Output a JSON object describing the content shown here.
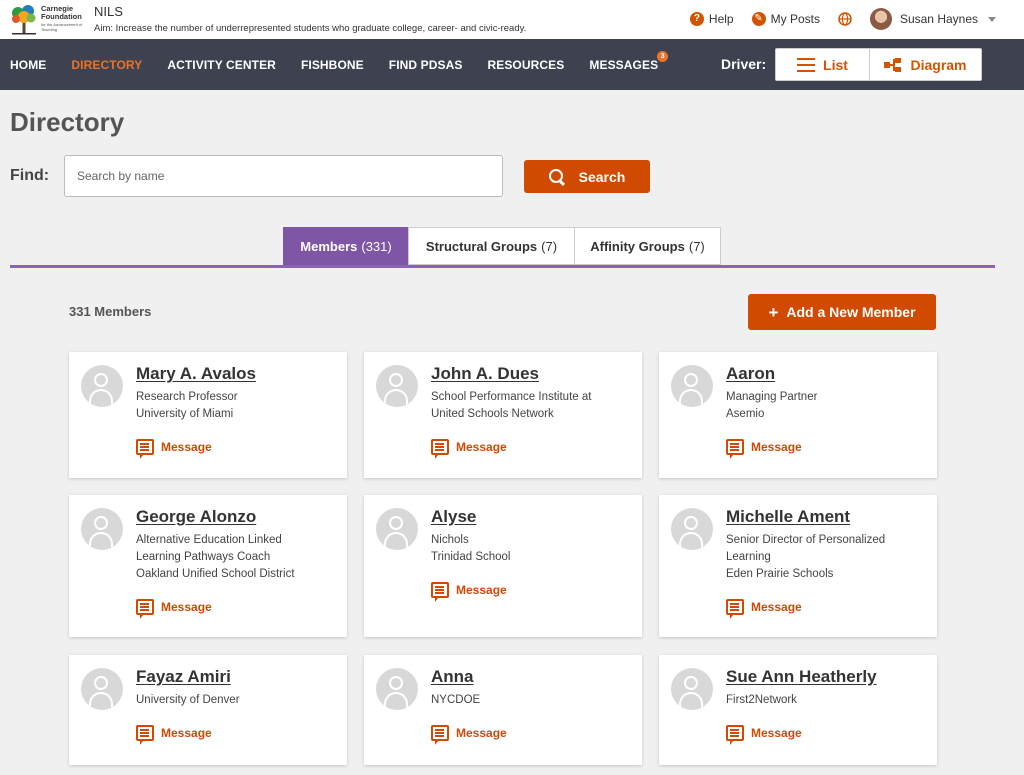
{
  "header": {
    "logo_line1": "Carnegie",
    "logo_line2": "Foundation",
    "logo_sub": "for the Advancement of Teaching",
    "app_name": "NILS",
    "aim": "Aim: Increase the number of underrepresented students who graduate college, career- and civic-ready.",
    "help": "Help",
    "my_posts": "My Posts",
    "user_name": "Susan Haynes"
  },
  "nav": {
    "items": [
      "HOME",
      "DIRECTORY",
      "ACTIVITY CENTER",
      "FISHBONE",
      "FIND PDSAS",
      "RESOURCES",
      "MESSAGES"
    ],
    "messages_badge": "3",
    "active": "DIRECTORY",
    "driver_label": "Driver:",
    "list_label": "List",
    "diagram_label": "Diagram"
  },
  "page": {
    "title": "Directory",
    "find_label": "Find:",
    "search_placeholder": "Search by name",
    "search_value": "",
    "search_button": "Search"
  },
  "tabs": [
    {
      "label": "Members",
      "count": "(331)",
      "active": true
    },
    {
      "label": "Structural Groups",
      "count": "(7)",
      "active": false
    },
    {
      "label": "Affinity Groups",
      "count": "(7)",
      "active": false
    }
  ],
  "members": {
    "count_label": "331 Members",
    "add_button": "Add a New Member",
    "message_label": "Message",
    "cards": [
      {
        "name": "Mary A. Avalos",
        "lines": [
          "Research Professor",
          "University of Miami"
        ]
      },
      {
        "name": "John A. Dues",
        "lines": [
          "School Performance Institute at",
          "United Schools Network"
        ]
      },
      {
        "name": "Aaron",
        "lines": [
          "Managing Partner",
          "Asemio"
        ]
      },
      {
        "name": "George Alonzo",
        "lines": [
          "Alternative Education Linked",
          "Learning Pathways Coach",
          "Oakland Unified School District"
        ]
      },
      {
        "name": "Alyse",
        "lines": [
          "Nichols",
          "Trinidad School"
        ]
      },
      {
        "name": "Michelle Ament",
        "lines": [
          "Senior Director of Personalized",
          "Learning",
          "Eden Prairie Schools"
        ]
      },
      {
        "name": "Fayaz Amiri",
        "lines": [
          "University of Denver"
        ]
      },
      {
        "name": "Anna",
        "lines": [
          "NYCDOE"
        ]
      },
      {
        "name": "Sue Ann Heatherly",
        "lines": [
          "First2Network"
        ]
      }
    ]
  },
  "colors": {
    "accent": "#d04a02",
    "nav_bg": "#3d4150",
    "tab_active": "#7f56a6"
  }
}
